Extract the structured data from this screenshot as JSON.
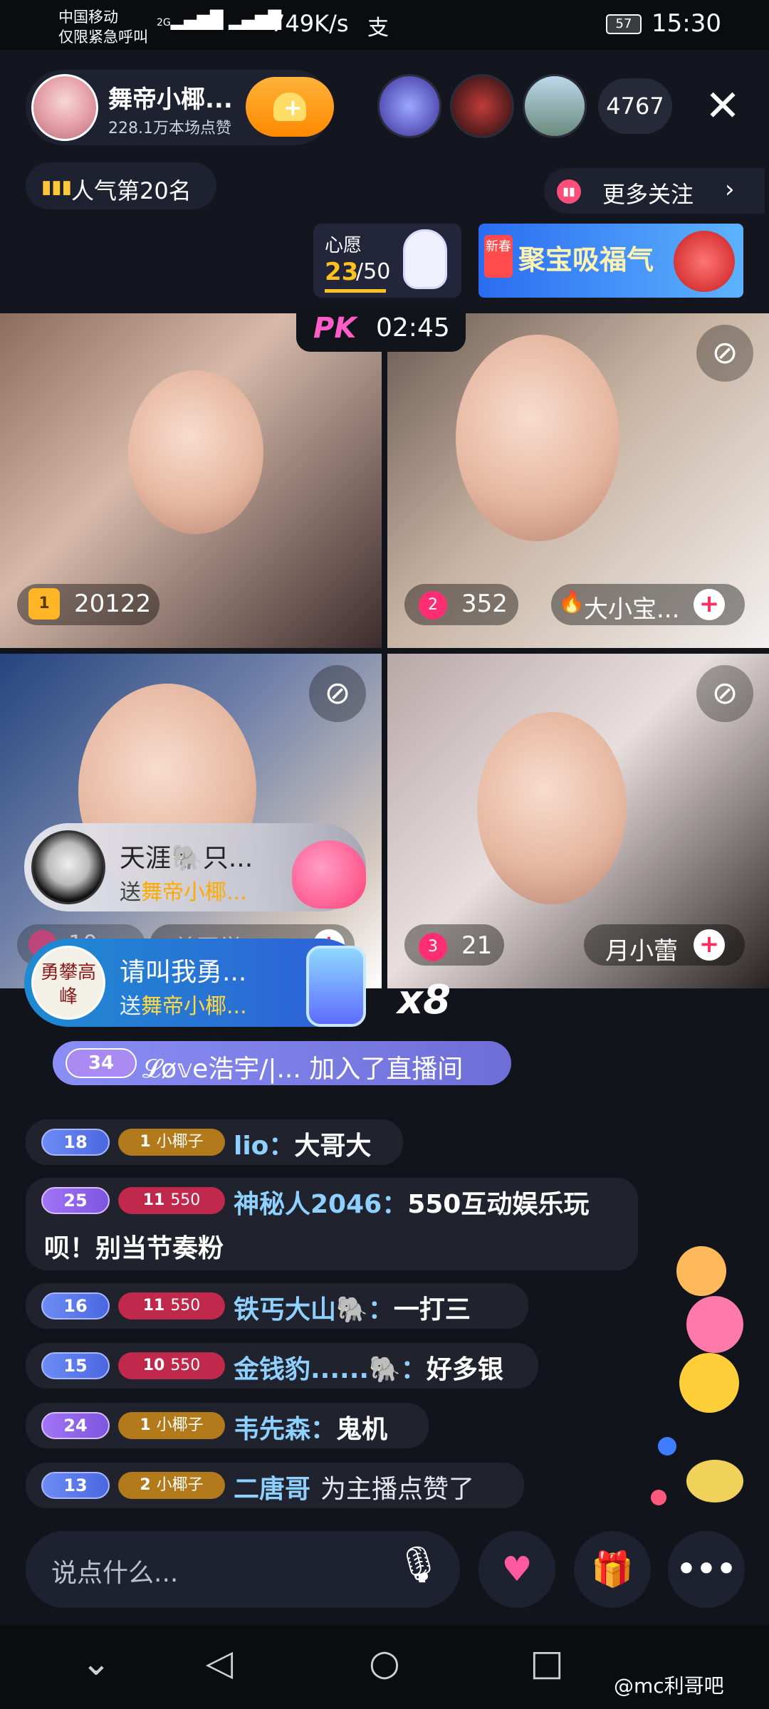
{
  "status": {
    "carrier_line1": "中国移动",
    "carrier_line2": "仅限紧急呼叫",
    "signal": "2G",
    "speed": "749K/s",
    "extra_icon": "支",
    "battery": "57",
    "time": "15:30"
  },
  "host": {
    "name": "舞帝小椰...",
    "likes": "228.1万本场点赞",
    "follow_icon": "add-heart-icon"
  },
  "viewers": {
    "count": "4767"
  },
  "rank": {
    "label": "人气第20名"
  },
  "more_follow": {
    "label": "更多关注"
  },
  "wish": {
    "label": "心愿",
    "current": "23",
    "total": "/50",
    "progress": 0.46
  },
  "promo": {
    "badge": "新春",
    "text": "聚宝吸福气"
  },
  "pk": {
    "logo": "PK",
    "timer": "02:45"
  },
  "participants": [
    {
      "rank_badge": "1",
      "score": "20122"
    },
    {
      "rank_badge": "2",
      "score": "352",
      "name": "大小宝..."
    },
    {
      "rank_badge": "",
      "score": "10",
      "name": "差同学..."
    },
    {
      "rank_badge": "3",
      "score": "21",
      "name": "月小蕾"
    }
  ],
  "gifts": [
    {
      "sender": "天涯🐘只...",
      "prefix": "送",
      "target": "舞帝小椰..."
    },
    {
      "avatar_text": "勇攀高峰",
      "sender": "请叫我勇...",
      "prefix": "送",
      "target": "舞帝小椰...",
      "combo": "x8"
    }
  ],
  "join": {
    "level": "34",
    "text": "𝓛ø𝕧e浩宇/|... 加入了直播间"
  },
  "chat": [
    {
      "level": "18",
      "fan_level": "1",
      "fan_label": "小椰子",
      "name": "lio：",
      "text": "大哥大"
    },
    {
      "level": "25",
      "fan_level": "11",
      "fan_label": "550",
      "name": "神秘人2046：",
      "text": "550互动娱乐玩",
      "text2": "呗！别当节奏粉"
    },
    {
      "level": "16",
      "fan_level": "11",
      "fan_label": "550",
      "name": "铁丐大山🐘：",
      "text": "一打三"
    },
    {
      "level": "15",
      "fan_level": "10",
      "fan_label": "550",
      "name": "金钱豹......🐘：",
      "text": "好多银"
    },
    {
      "level": "24",
      "fan_level": "1",
      "fan_label": "小椰子",
      "name": "韦先森：",
      "text": "鬼机"
    },
    {
      "level": "13",
      "fan_level": "2",
      "fan_label": "小椰子",
      "name": "二唐哥",
      "text": "为主播点赞了"
    }
  ],
  "input": {
    "placeholder": "说点什么..."
  },
  "watermark": "@mc利哥吧"
}
